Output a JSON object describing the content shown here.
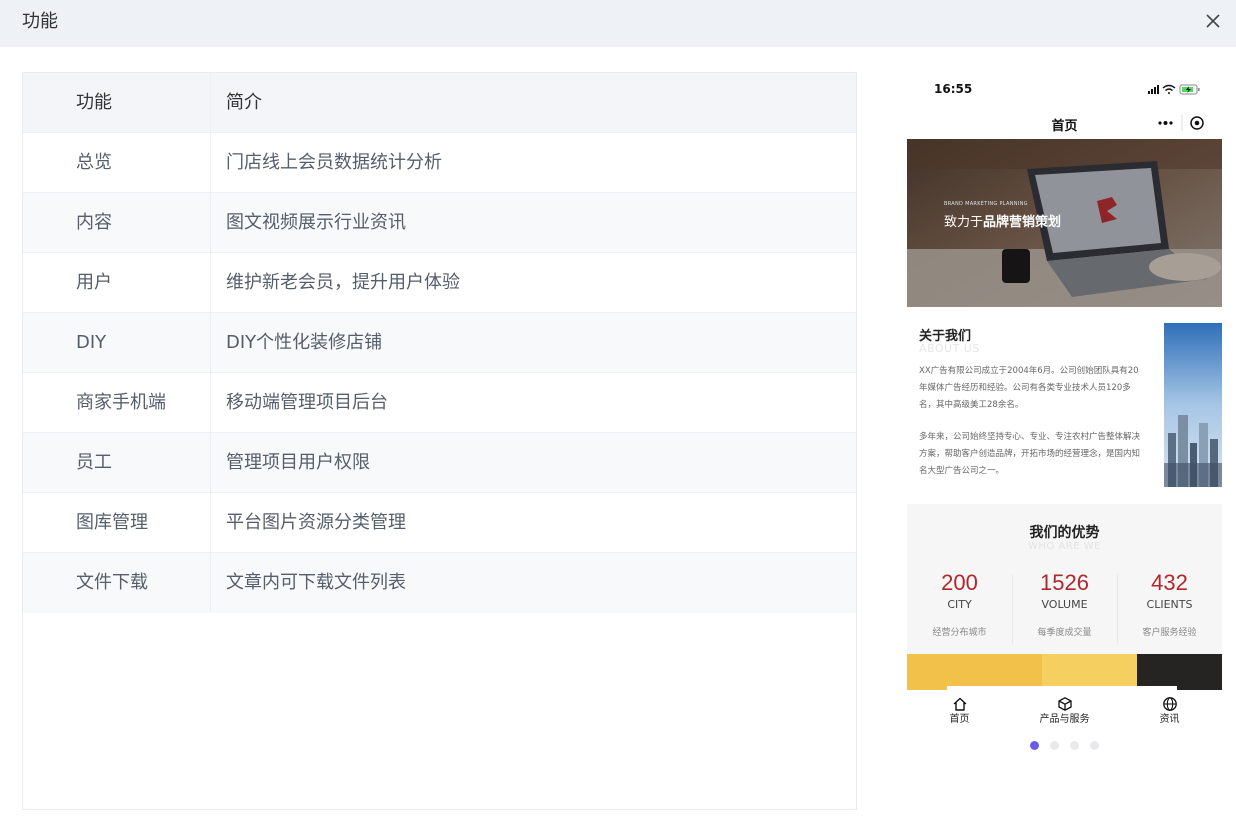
{
  "dialog": {
    "title": "功能"
  },
  "table": {
    "headers": [
      "功能",
      "简介"
    ],
    "rows": [
      [
        "总览",
        "门店线上会员数据统计分析"
      ],
      [
        "内容",
        "图文视频展示行业资讯"
      ],
      [
        "用户",
        "维护新老会员，提升用户体验"
      ],
      [
        "DIY",
        "DIY个性化装修店铺"
      ],
      [
        "商家手机端",
        "移动端管理项目后台"
      ],
      [
        "员工",
        "管理项目用户权限"
      ],
      [
        "图库管理",
        "平台图片资源分类管理"
      ],
      [
        "文件下载",
        "文章内可下载文件列表"
      ]
    ]
  },
  "preview": {
    "status_time": "16:55",
    "nav_title": "首页",
    "banner": {
      "small": "BRAND MARKETING PLANNING",
      "main_prefix": "致力于",
      "main_bold": "品牌营销策划"
    },
    "about": {
      "title": "关于我们",
      "en": "ABOUT US",
      "p1": "XX广告有限公司成立于2004年6月。公司创始团队具有20年媒体广告经历和经验。公司有各类专业技术人员120多名，其中高级美工28余名。",
      "p2": "多年来，公司始终坚持专心、专业、专注农村广告整体解决方案，帮助客户创造品牌，开拓市场的经营理念，是国内知名大型广告公司之一。"
    },
    "advantages": {
      "title": "我们的优势",
      "en": "WHO ARE WE",
      "stats": [
        {
          "num": "200",
          "unit": "CITY",
          "desc": "经营分布城市"
        },
        {
          "num": "1526",
          "unit": "VOLUME",
          "desc": "每季度成交量"
        },
        {
          "num": "432",
          "unit": "CLIENTS",
          "desc": "客户服务经验"
        }
      ]
    },
    "tabs": [
      "首页",
      "产品与服务",
      "资讯"
    ]
  },
  "carousel": {
    "total": 4,
    "active": 0
  },
  "colors": {
    "accent": "#6c5be7",
    "stat_red": "#b0282c",
    "header_bg": "#eef1f5"
  }
}
